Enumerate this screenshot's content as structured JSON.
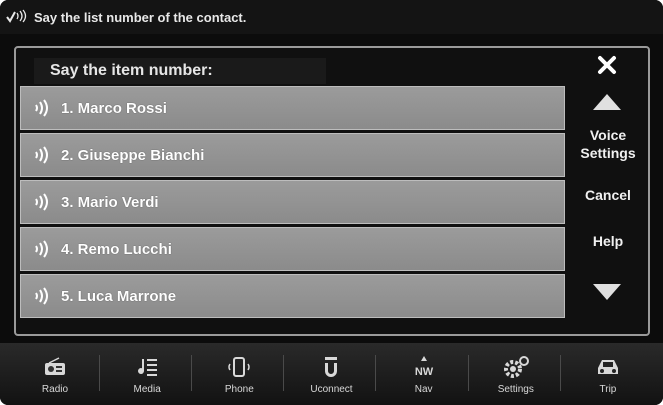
{
  "prompt": {
    "text": "Say the list number of the contact.",
    "icon": "voice-recognition-icon"
  },
  "panel": {
    "header": "Say the item number:"
  },
  "contacts": [
    {
      "label": "1. Marco Rossi"
    },
    {
      "label": "2. Giuseppe Bianchi"
    },
    {
      "label": "3. Mario Verdi"
    },
    {
      "label": "4. Remo Lucchi"
    },
    {
      "label": "5. Luca Marrone"
    }
  ],
  "side": {
    "voice_settings": "Voice Settings",
    "cancel": "Cancel",
    "help": "Help"
  },
  "nav": [
    {
      "label": "Radio",
      "icon": "radio-icon"
    },
    {
      "label": "Media",
      "icon": "media-icon"
    },
    {
      "label": "Phone",
      "icon": "phone-icon"
    },
    {
      "label": "Uconnect",
      "icon": "uconnect-icon"
    },
    {
      "label": "Nav",
      "icon": "compass-icon",
      "compass": "NW"
    },
    {
      "label": "Settings",
      "icon": "gears-icon"
    },
    {
      "label": "Trip",
      "icon": "car-icon"
    }
  ]
}
